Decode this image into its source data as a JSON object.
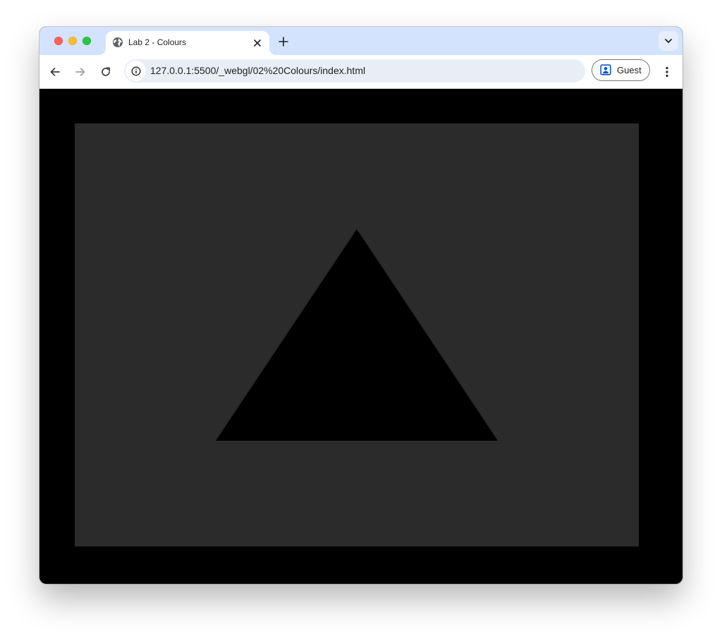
{
  "browser": {
    "tab": {
      "title": "Lab 2 - Colours",
      "favicon_icon": "globe-icon",
      "close_icon": "close-icon"
    },
    "new_tab_icon": "plus-icon",
    "tab_search_icon": "chevron-down-icon",
    "nav": {
      "back_icon": "arrow-left-icon",
      "forward_icon": "arrow-right-icon",
      "reload_icon": "reload-icon"
    },
    "address_bar": {
      "site_info_icon": "info-icon",
      "url": "127.0.0.1:5500/_webgl/02%20Colours/index.html"
    },
    "profile": {
      "label": "Guest",
      "icon": "guest-profile-icon"
    },
    "menu_icon": "kebab-menu-icon",
    "window_controls": [
      "close",
      "minimize",
      "maximize"
    ]
  },
  "page": {
    "background_color": "#000000",
    "canvas": {
      "clear_color": "#2b2b2b",
      "shape": "triangle",
      "shape_color": "#000000",
      "vertices_clip": [
        [
          0.0,
          0.5
        ],
        [
          -0.5,
          -0.5
        ],
        [
          0.5,
          -0.5
        ]
      ]
    }
  }
}
